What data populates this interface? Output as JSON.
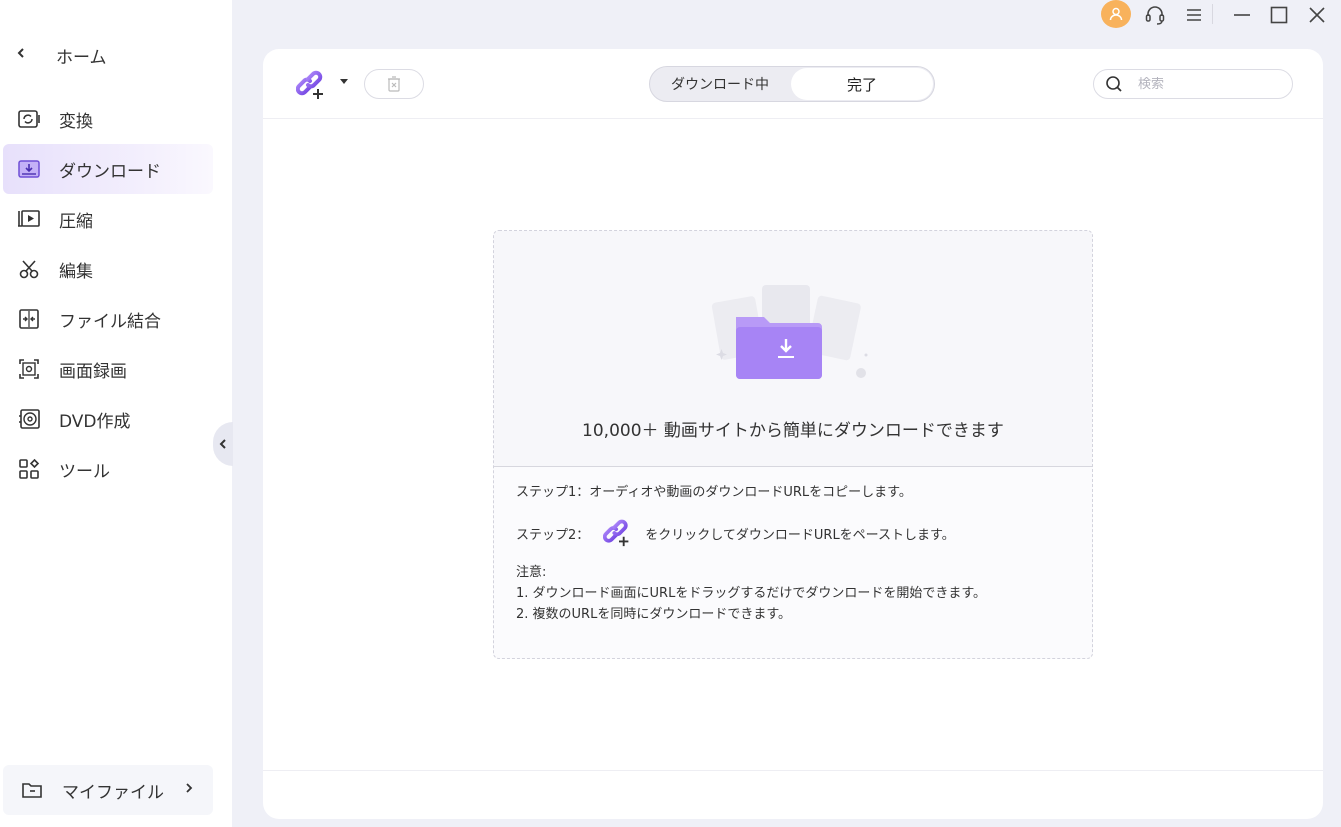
{
  "sidebar": {
    "home_label": "ホーム",
    "items": [
      {
        "label": "変換",
        "icon": "convert-icon"
      },
      {
        "label": "ダウンロード",
        "icon": "download-icon",
        "active": true
      },
      {
        "label": "圧縮",
        "icon": "compress-icon"
      },
      {
        "label": "編集",
        "icon": "scissors-icon"
      },
      {
        "label": "ファイル結合",
        "icon": "merge-icon"
      },
      {
        "label": "画面録画",
        "icon": "screen-record-icon"
      },
      {
        "label": "DVD作成",
        "icon": "dvd-icon"
      },
      {
        "label": "ツール",
        "icon": "tools-grid-icon"
      }
    ],
    "my_files_label": "マイファイル"
  },
  "colors": {
    "accent": "#8b5cf6",
    "avatar": "#f8b25c",
    "active_bg": "#e7e0fb"
  },
  "toolbar": {
    "tabs": [
      "ダウンロード中",
      "完了"
    ],
    "selected_tab": "完了",
    "search_placeholder": "検索"
  },
  "empty_state": {
    "headline": "10,000＋ 動画サイトから簡単にダウンロードできます",
    "step1": "ステップ1：オーディオや動画のダウンロードURLをコピーします。",
    "step2_prefix": "ステップ2：",
    "step2_suffix": "をクリックしてダウンロードURLをペーストします。",
    "note_title": "注意:",
    "note1": "1. ダウンロード画面にURLをドラッグするだけでダウンロードを開始できます。",
    "note2": "2. 複数のURLを同時にダウンロードできます。"
  }
}
